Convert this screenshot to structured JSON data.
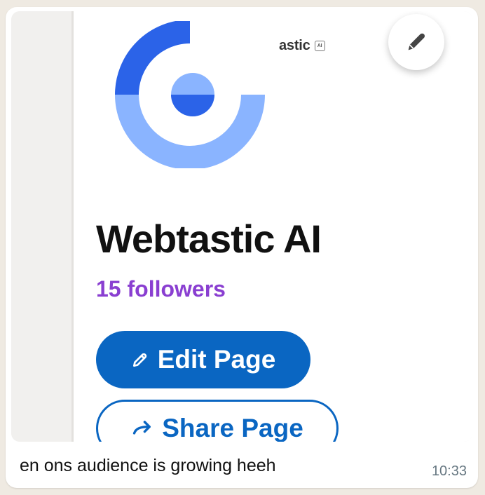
{
  "message": {
    "caption": "en ons audience is growing heeh",
    "timestamp": "10:33"
  },
  "shared_image": {
    "company_badge": "astic",
    "badge_icon": "ai-mini-icon",
    "page_name": "Webtastic AI",
    "followers": "15 followers",
    "edit_button": "Edit Page",
    "share_button": "Share Page"
  },
  "actions": {
    "edit_icon": "pencil-icon"
  },
  "colors": {
    "chat_background": "#efeae2",
    "bubble": "#ffffff",
    "primary_blue": "#0a66c2",
    "followers_purple": "#8a3fd1",
    "logo_dark_blue": "#2b63e8",
    "logo_light_blue": "#8ab4ff"
  }
}
